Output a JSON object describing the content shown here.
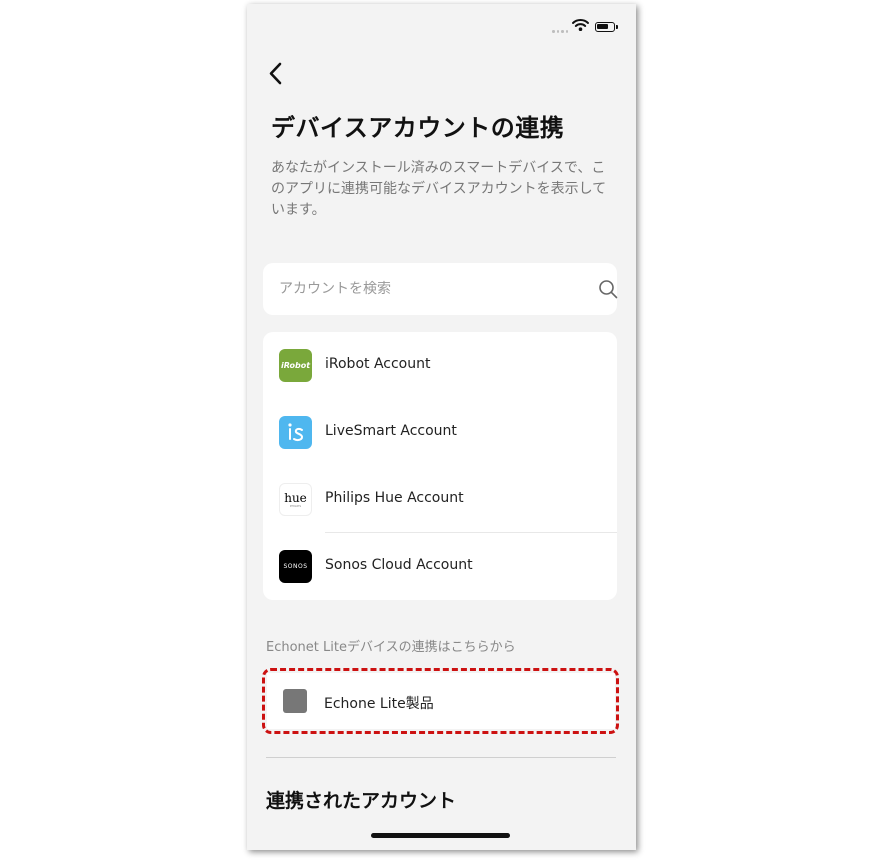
{
  "header": {
    "title": "デバイスアカウントの連携",
    "description": "あなたがインストール済みのスマートデバイスで、このアプリに連携可能なデバイスアカウントを表示しています。"
  },
  "search": {
    "placeholder": "アカウントを検索",
    "value": ""
  },
  "accounts": [
    {
      "label": "iRobot Account",
      "logo_text": "iRobot",
      "icon": "irobot-logo",
      "color": "#7aa83b"
    },
    {
      "label": "LiveSmart Account",
      "icon": "livesmart-logo",
      "color": "#4fb7ef"
    },
    {
      "label": "Philips Hue Account",
      "logo_text": "hue",
      "logo_subtext": "PHILIPS",
      "icon": "philips-hue-logo",
      "color": "#ffffff"
    },
    {
      "label": "Sonos Cloud Account",
      "logo_text": "SONOS",
      "icon": "sonos-logo",
      "color": "#000000"
    }
  ],
  "echonet": {
    "section_label": "Echonet Liteデバイスの連携はこちらから",
    "item_label": "Echone Lite製品",
    "highlight_color": "#cc1111"
  },
  "linked": {
    "title": "連携されたアカウント"
  }
}
